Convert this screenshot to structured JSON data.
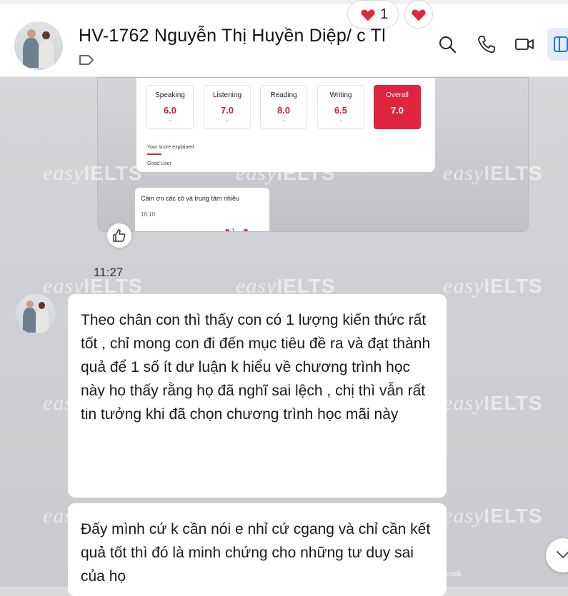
{
  "header": {
    "title": "HV-1762 Nguyễn Thị Huyền Diệp/ c Tl",
    "icons": [
      "tag-icon",
      "search-icon",
      "phone-icon",
      "video-icon",
      "sidebar-toggle-icon"
    ]
  },
  "watermark": {
    "text": "easy",
    "brand": "IELTS"
  },
  "image_card": {
    "scores": [
      {
        "label": "Speaking",
        "value": "6.0"
      },
      {
        "label": "Listening",
        "value": "7.0"
      },
      {
        "label": "Reading",
        "value": "8.0"
      },
      {
        "label": "Writing",
        "value": "6.5"
      },
      {
        "label": "Overall",
        "value": "7.0"
      }
    ],
    "explained": "Your score explained",
    "user": "Good User",
    "inner_message": "Cảm ơn các cô và trung tâm nhiều",
    "inner_time": "16:10",
    "inner_reaction_count": "1"
  },
  "timestamp": "11:27",
  "messages": [
    {
      "text": "Theo chân con thì thấy con có 1 lượng kiến thức rất tốt , chỉ mong  con đi đến mục tiêu đề ra và đạt thành quả để  1 số ít dư luận k hiểu về chương trình học này họ thấy rằng họ đã nghĩ sai lệch , chị thì vẫn rất tin tưởng khi đã chọn chương trình học mãi này",
      "reaction_count": "1"
    },
    {
      "text": "Đấy mình cứ k cần nói e nhỉ cứ cgang và chỉ cần kết quả tốt thì đó là minh chứng cho những tư duy sai của họ"
    }
  ],
  "footnote": "Image was created using the free version of Watermarkly. The paid version does not add this mark.",
  "colors": {
    "score_red": "#d21f3c",
    "heart": "#e0283f",
    "accent_blue": "#1a73e8"
  }
}
